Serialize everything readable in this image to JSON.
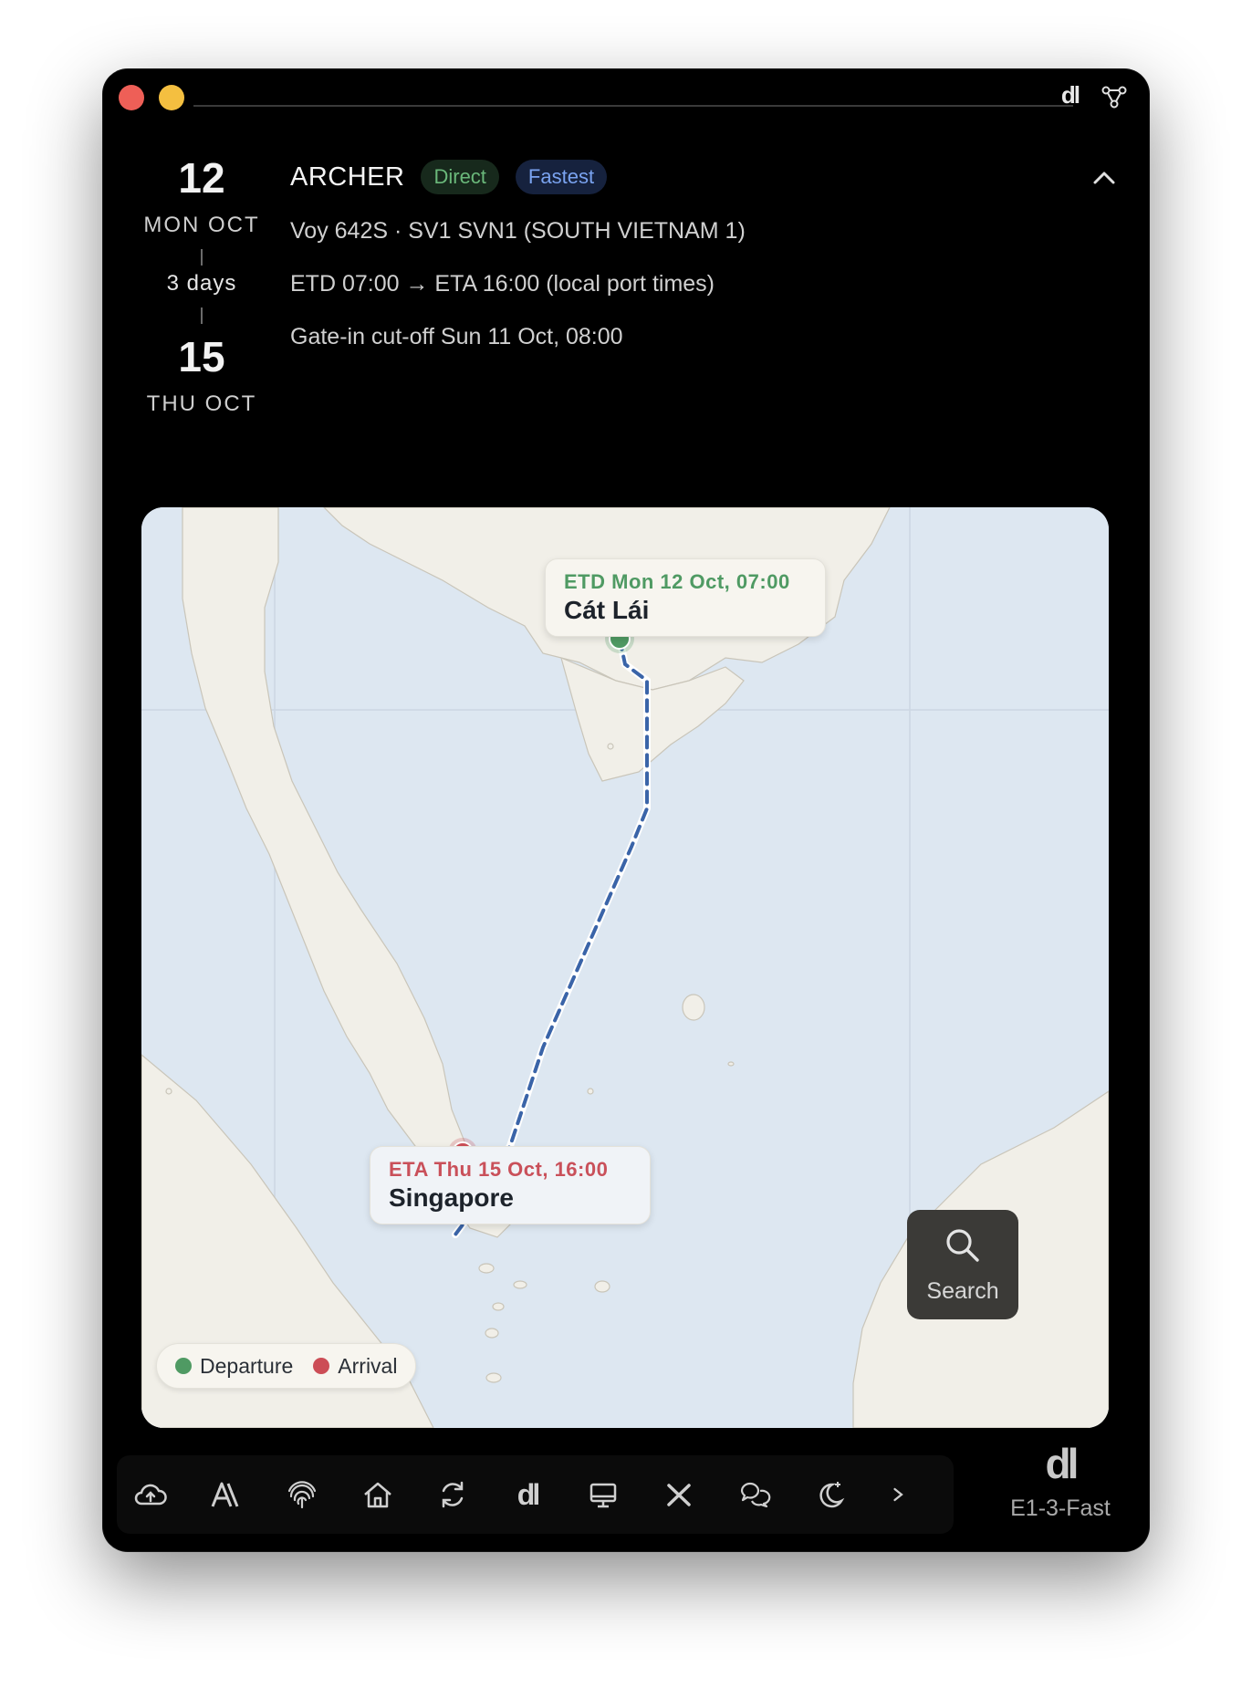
{
  "titlebar": {
    "logo": "dl",
    "network_icon": "network-graph-icon"
  },
  "schedule": {
    "departure": {
      "day": "12",
      "label": "MON OCT"
    },
    "duration": "3 days",
    "arrival": {
      "day": "15",
      "label": "THU OCT"
    }
  },
  "voyage": {
    "vessel": "ARCHER",
    "badges": {
      "direct": "Direct",
      "fastest": "Fastest"
    },
    "service": "Voy 642S · SV1 SVN1 (SOUTH VIETNAM 1)",
    "times": "ETD 07:00 → ETA 16:00 (local port times)",
    "cutoff": "Gate-in cut-off Sun 11 Oct, 08:00"
  },
  "map": {
    "departure_callout": {
      "when": "ETD Mon 12 Oct, 07:00",
      "port": "Cát Lái"
    },
    "arrival_callout": {
      "when": "ETA Thu 15 Oct, 16:00",
      "port": "Singapore"
    },
    "legend": {
      "departure": "Departure",
      "arrival": "Arrival"
    },
    "colors": {
      "water": "#dde7f1",
      "land": "#f1efe8",
      "route": "#3a64a8",
      "departure": "#4f9a63",
      "arrival": "#cc4d56"
    }
  },
  "search": {
    "label": "Search"
  },
  "dock": {
    "icons": [
      "cloud-upload-icon",
      "ai-icon",
      "fingerprint-icon",
      "home-icon",
      "refresh-icon",
      "dl-logo-icon",
      "monitor-icon",
      "x-icon",
      "chat-icon",
      "moon-stars-icon",
      "more-icon"
    ],
    "dl_label": "dl",
    "ai_label": "A\\"
  },
  "profile": {
    "logo": "dl",
    "name": "E1-3-Fast"
  }
}
